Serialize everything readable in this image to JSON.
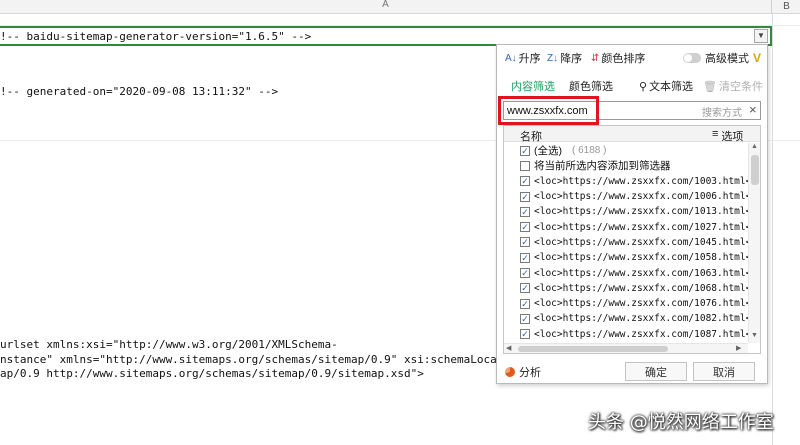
{
  "sheet": {
    "col_a": "A",
    "col_b": "B",
    "lines": [
      "!-- baidu-sitemap-generator-version=\"1.6.5\" -->",
      "!-- generated-on=\"2020-09-08 13:11:32\" -->",
      "urlset xmlns:xsi=\"http://www.w3.org/2001/XMLSchema-",
      "nstance\" xmlns=\"http://www.sitemaps.org/schemas/sitemap/0.9\" xsi:schemaLocat",
      "ap/0.9 http://www.sitemaps.org/schemas/sitemap/0.9/sitemap.xsd\">"
    ]
  },
  "panel": {
    "sort_asc": "升序",
    "sort_desc": "降序",
    "sort_color": "颜色排序",
    "advanced_mode": "高级模式",
    "vip_mark": "V",
    "tab_content": "内容筛选",
    "tab_color": "颜色筛选",
    "text_filter": "文本筛选",
    "clear_conditions": "清空条件",
    "search_value": "www.zsxxfx.com",
    "search_mode": "搜索方式",
    "list_header_name": "名称",
    "list_header_options": "选项",
    "select_all": "(全选)",
    "select_all_count": "( 6188 )",
    "add_to_filter": "将当前所选内容添加到筛选器",
    "items": [
      "<loc>https://www.zsxxfx.com/1003.html</l",
      "<loc>https://www.zsxxfx.com/1006.html</l",
      "<loc>https://www.zsxxfx.com/1013.html</l",
      "<loc>https://www.zsxxfx.com/1027.html</l",
      "<loc>https://www.zsxxfx.com/1045.html</l",
      "<loc>https://www.zsxxfx.com/1058.html</l",
      "<loc>https://www.zsxxfx.com/1063.html</l",
      "<loc>https://www.zsxxfx.com/1068.html</l",
      "<loc>https://www.zsxxfx.com/1076.html</l",
      "<loc>https://www.zsxxfx.com/1082.html</l",
      "<loc>https://www.zsxxfx.com/1087.html</l"
    ],
    "analyze": "分析",
    "ok": "确定",
    "cancel": "取消"
  },
  "watermark": "头条 @悦然网络工作室",
  "colors": {
    "accent_green": "#1aa260",
    "cell_border": "#2e8b3e",
    "highlight_red": "#e0141e",
    "checkbox_blue": "#2b5fc6"
  }
}
